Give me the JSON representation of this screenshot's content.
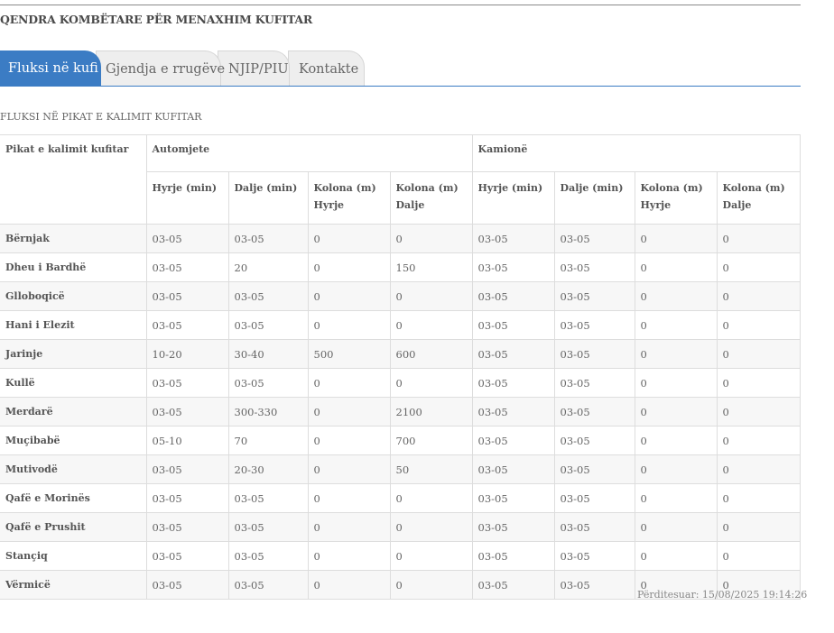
{
  "header": {
    "org_title": "QENDRA KOMBËTARE PËR MENAXHIM KUFITAR"
  },
  "tabs": [
    {
      "label": "Fluksi në kufi",
      "active": true
    },
    {
      "label": "Gjendja e rrugëve",
      "active": false
    },
    {
      "label": "NJIP/PIU",
      "active": false
    },
    {
      "label": "Kontakte",
      "active": false
    }
  ],
  "section_title": "FLUKSI NË PIKAT E KALIMIT KUFITAR",
  "table": {
    "header_col": "Pikat e kalimit kufitar",
    "group_cars": "Automjete",
    "group_trucks": "Kamionë",
    "sub_headers": [
      "Hyrje (min)",
      "Dalje (min)",
      "Kolona (m) Hyrje",
      "Kolona (m) Dalje",
      "Hyrje (min)",
      "Dalje (min)",
      "Kolona (m) Hyrje",
      "Kolona (m) Dalje"
    ],
    "rows": [
      {
        "name": "Bërnjak",
        "vals": [
          "03-05",
          "03-05",
          "0",
          "0",
          "03-05",
          "03-05",
          "0",
          "0"
        ]
      },
      {
        "name": "Dheu i Bardhë",
        "vals": [
          "03-05",
          "20",
          "0",
          "150",
          "03-05",
          "03-05",
          "0",
          "0"
        ]
      },
      {
        "name": "Glloboqicë",
        "vals": [
          "03-05",
          "03-05",
          "0",
          "0",
          "03-05",
          "03-05",
          "0",
          "0"
        ]
      },
      {
        "name": "Hani i Elezit",
        "vals": [
          "03-05",
          "03-05",
          "0",
          "0",
          "03-05",
          "03-05",
          "0",
          "0"
        ]
      },
      {
        "name": "Jarinje",
        "vals": [
          "10-20",
          "30-40",
          "500",
          "600",
          "03-05",
          "03-05",
          "0",
          "0"
        ]
      },
      {
        "name": "Kullë",
        "vals": [
          "03-05",
          "03-05",
          "0",
          "0",
          "03-05",
          "03-05",
          "0",
          "0"
        ]
      },
      {
        "name": "Merdarë",
        "vals": [
          "03-05",
          "300-330",
          "0",
          "2100",
          "03-05",
          "03-05",
          "0",
          "0"
        ]
      },
      {
        "name": "Muçibabë",
        "vals": [
          "05-10",
          "70",
          "0",
          "700",
          "03-05",
          "03-05",
          "0",
          "0"
        ]
      },
      {
        "name": "Mutivodë",
        "vals": [
          "03-05",
          "20-30",
          "0",
          "50",
          "03-05",
          "03-05",
          "0",
          "0"
        ]
      },
      {
        "name": "Qafë e Morinës",
        "vals": [
          "03-05",
          "03-05",
          "0",
          "0",
          "03-05",
          "03-05",
          "0",
          "0"
        ]
      },
      {
        "name": "Qafë e Prushit",
        "vals": [
          "03-05",
          "03-05",
          "0",
          "0",
          "03-05",
          "03-05",
          "0",
          "0"
        ]
      },
      {
        "name": "Stançiq",
        "vals": [
          "03-05",
          "03-05",
          "0",
          "0",
          "03-05",
          "03-05",
          "0",
          "0"
        ]
      },
      {
        "name": "Vërmicë",
        "vals": [
          "03-05",
          "03-05",
          "0",
          "0",
          "03-05",
          "03-05",
          "0",
          "0"
        ]
      }
    ]
  },
  "updated_text": "Përditesuar: 15/08/2025 19:14:26",
  "colors": {
    "accent": "#3b7cc4",
    "row_alt": "#f7f7f7",
    "border": "#dddddd"
  }
}
